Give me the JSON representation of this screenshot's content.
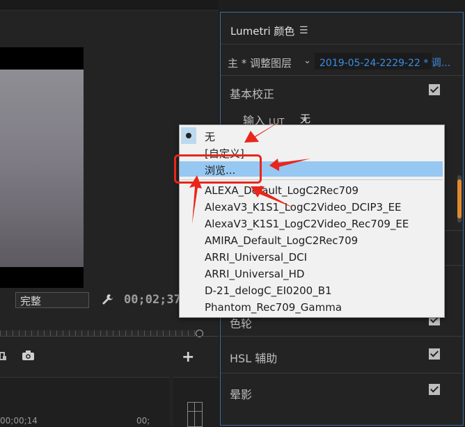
{
  "monitor": {
    "quality": "完整",
    "timecode": "00;02;37",
    "tc_left": "00;00;14",
    "tc_right": "00;"
  },
  "lumetri": {
    "title": "Lumetri 颜色",
    "master_label": "主 * 调整图层",
    "clip_label": "2019-05-24-2229-22 * 调...",
    "section_basic": "基本校正",
    "input_lut_label": "输入",
    "input_lut_suffix": "LUT",
    "input_lut_value": "无",
    "sections_below": [
      {
        "label": "色轮"
      },
      {
        "label": "HSL 辅助"
      },
      {
        "label": "晕影"
      }
    ]
  },
  "lut_menu": {
    "items": [
      "无",
      "[自定义]",
      "浏览...",
      "ALEXA_Default_LogC2Rec709",
      "AlexaV3_K1S1_LogC2Video_DCIP3_EE",
      "AlexaV3_K1S1_LogC2Video_Rec709_EE",
      "AMIRA_Default_LogC2Rec709",
      "ARRI_Universal_DCI",
      "ARRI_Universal_HD",
      "D-21_delogC_EI0200_B1",
      "Phantom_Rec709_Gamma"
    ],
    "selected_index": 0,
    "hovered_index": 2
  },
  "colors": {
    "accent_blue": "#3a8ee6",
    "highlight": "#96c8f2",
    "annotation_red": "#e8261b",
    "scroll_orange": "#e08a30"
  },
  "icons": {
    "wrench": "wrench-icon",
    "camera": "camera-icon",
    "plus": "plus-icon",
    "menu": "hamburger-icon"
  }
}
